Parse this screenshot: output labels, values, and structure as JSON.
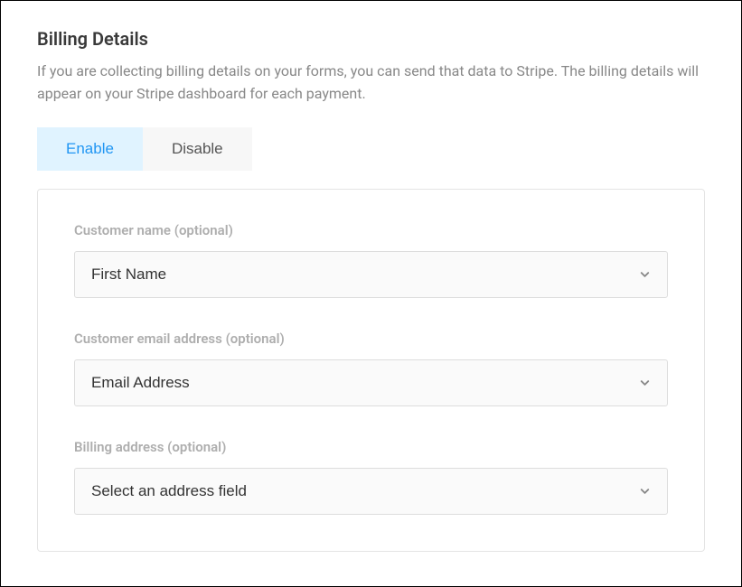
{
  "section": {
    "title": "Billing Details",
    "description": "If you are collecting billing details on your forms, you can send that data to Stripe. The billing details will appear on your Stripe dashboard for each payment."
  },
  "toggle": {
    "enable_label": "Enable",
    "disable_label": "Disable"
  },
  "fields": {
    "customer_name": {
      "label": "Customer name (optional)",
      "value": "First Name"
    },
    "customer_email": {
      "label": "Customer email address (optional)",
      "value": "Email Address"
    },
    "billing_address": {
      "label": "Billing address (optional)",
      "value": "Select an address field"
    }
  }
}
